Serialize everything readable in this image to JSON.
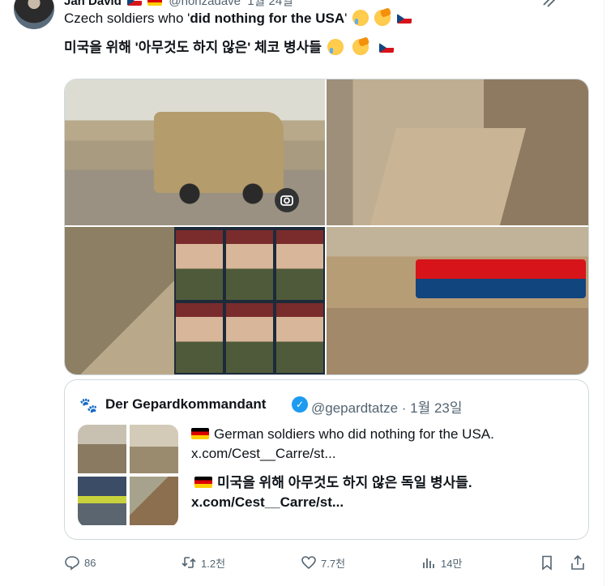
{
  "tweet": {
    "author_name": "Jan David",
    "author_handle": "@honzadave",
    "time": "1월 24일",
    "line1_prefix": "Czech soldiers who '",
    "line1_bold": "did nothing for the USA",
    "line1_suffix": "'",
    "line2": "미국을 위해 '아무것도 하지 않은' 체코 병사들"
  },
  "quote": {
    "author_name": "Der Gepardkommandant",
    "handle_time": "@gepardtatze · 1월 23일",
    "line1": "German soldiers who did nothing for the USA.",
    "link1": "x.com/Cest__Carre/st...",
    "line2": "미국을 위해 아무것도 하지 않은 독일 병사들.",
    "link2": "x.com/Cest__Carre/st..."
  },
  "actions": {
    "replies": "86",
    "reposts": "1.2천",
    "likes": "7.7천",
    "views": "14만"
  },
  "colors": {
    "text": "#0f1419",
    "muted": "#536471",
    "verified": "#1d9bf0",
    "border": "#cfd9de"
  }
}
